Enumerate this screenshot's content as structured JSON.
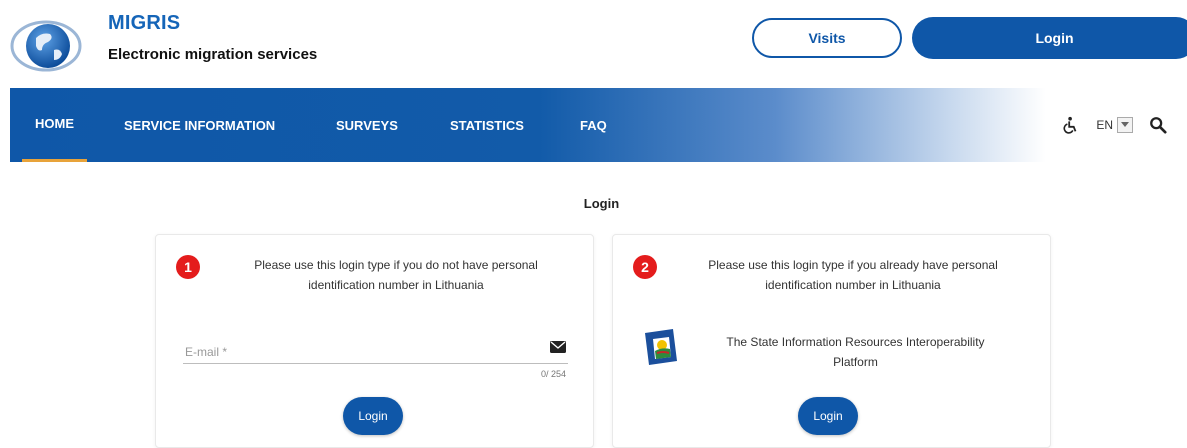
{
  "header": {
    "brand_title": "MIGRIS",
    "brand_subtitle": "Electronic migration services",
    "visits_label": "Visits",
    "login_label": "Login"
  },
  "nav": {
    "items": [
      {
        "label": "HOME",
        "active": true
      },
      {
        "label": "SERVICE INFORMATION"
      },
      {
        "label": "SURVEYS"
      },
      {
        "label": "STATISTICS"
      },
      {
        "label": "FAQ"
      }
    ],
    "language": "EN",
    "icons": [
      "accessibility-icon",
      "search-icon"
    ]
  },
  "page": {
    "title": "Login"
  },
  "card1": {
    "step": "1",
    "text_line1": "Please use this login type if you do not have personal",
    "text_line2": "identification number in Lithuania",
    "email_placeholder": "E-mail *",
    "char_count": "0/ 254",
    "login_label": "Login"
  },
  "card2": {
    "step": "2",
    "text_line1": "Please use this login type if you already have personal",
    "text_line2": "identification number in Lithuania",
    "platform_line1": "The State Information Resources Interoperability",
    "platform_line2": "Platform",
    "login_label": "Login"
  },
  "colors": {
    "primary": "#0f57a8",
    "step_badge": "#e41c1c",
    "active_underline": "#e8a33a"
  }
}
